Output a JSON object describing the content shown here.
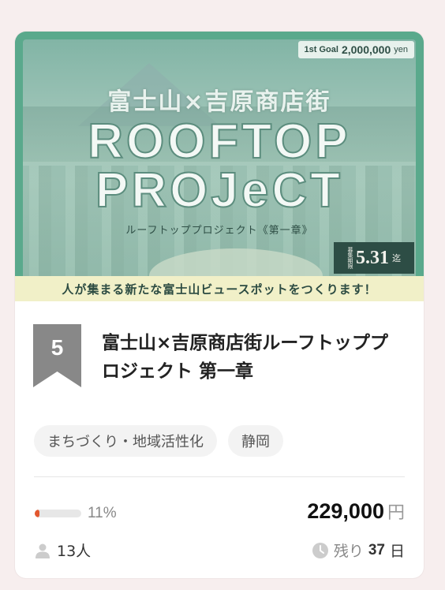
{
  "banner": {
    "goal_label": "1st Goal",
    "goal_amount": "2,000,000",
    "goal_currency": "yen",
    "title_jp": "富士山×吉原商店街",
    "title_line1": "ROOFTOP",
    "title_line2": "PROJeCT",
    "subtitle": "ルーフトッププロジェクト《第一章》",
    "deadline_label": "募集期限",
    "deadline_date": "5.31",
    "deadline_suffix": "迄",
    "tagline": "人が集まる新たな富士山ビュースポットをつくります！"
  },
  "rank": "5",
  "project": {
    "title": "富士山×吉原商店街ルーフトッププロジェクト 第一章"
  },
  "tags": [
    "まちづくり・地域活性化",
    "静岡"
  ],
  "stats": {
    "progress_percent": 11,
    "progress_text": "11%",
    "amount": "229,000",
    "currency": "円",
    "supporters": "13人",
    "remaining_label": "残り",
    "remaining_days": "37",
    "remaining_unit": "日"
  },
  "colors": {
    "progress_fill": "#e2572e",
    "banner_frame": "#5aa98c",
    "rank_badge": "#888888"
  },
  "icons": [
    "person-icon",
    "clock-icon"
  ]
}
